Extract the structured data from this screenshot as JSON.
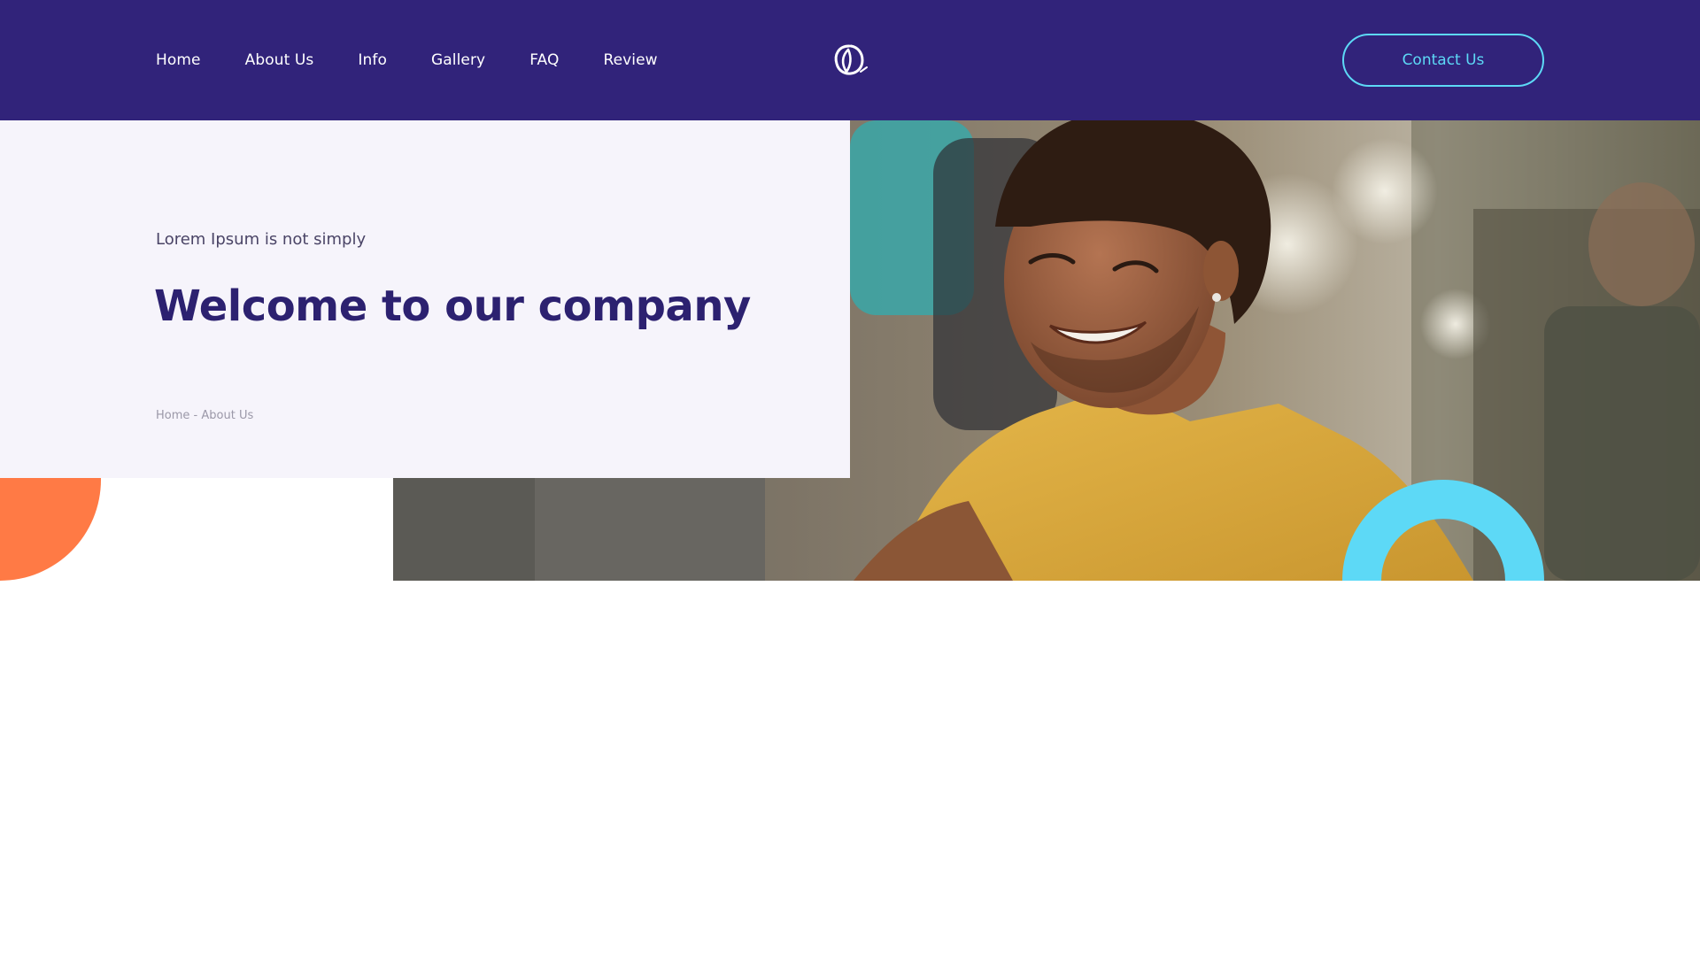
{
  "header": {
    "nav": [
      {
        "label": "Home"
      },
      {
        "label": "About Us"
      },
      {
        "label": "Info"
      },
      {
        "label": "Gallery"
      },
      {
        "label": "FAQ"
      },
      {
        "label": "Review"
      }
    ],
    "logo_icon": "leaf-swirl-icon",
    "contact_label": "Contact Us"
  },
  "hero": {
    "eyebrow": "Lorem Ipsum is not simply",
    "title": "Welcome to our company",
    "breadcrumb": {
      "home": "Home",
      "separator": "-",
      "current": "About Us"
    },
    "photo": "smiling-man-yellow-tshirt-cafe"
  },
  "colors": {
    "header_bg": "#31237a",
    "accent_cyan": "#5dd9f6",
    "accent_orange": "#ff7a45",
    "title": "#2c2170",
    "panel_bg": "#f6f4fb"
  }
}
